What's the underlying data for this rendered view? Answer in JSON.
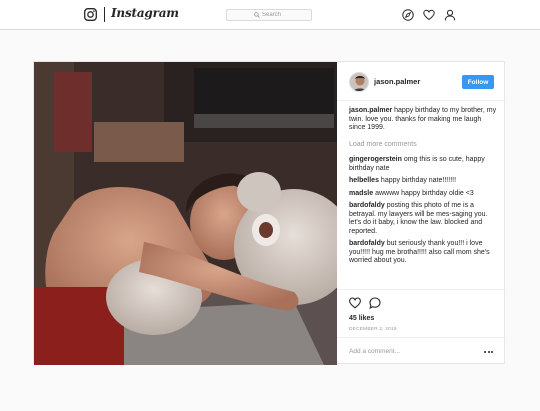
{
  "header": {
    "brand": "Instagram",
    "search_placeholder": "Search",
    "icons": [
      "instagram-glyph-icon",
      "compass-icon",
      "heart-icon",
      "profile-icon"
    ]
  },
  "post": {
    "username": "jason.palmer",
    "follow_label": "Follow",
    "photo_description_icon": "photo",
    "caption": {
      "user": "jason.palmer",
      "text": "happy birthday to my brother, my twin. love you. thanks for making me laugh since 1999."
    },
    "load_more": "Load more comments",
    "comments": [
      {
        "user": "gingerogerstein",
        "text": "omg this is so cute, happy birthday nate"
      },
      {
        "user": "helbelles",
        "text": "happy birthday nate!!!!!!!"
      },
      {
        "user": "madsle",
        "text": "awwww happy birthday oldie <3"
      },
      {
        "user": "bardofaldy",
        "text": "posting this photo of me is a betrayal. my lawyers will be mes-saging you. let's do it baby, i know the law. blocked and reported."
      },
      {
        "user": "bardofaldy",
        "text": "but seriously thank you!!! i love you!!!!! hug me brotha!!!!! also call mom she's worried about you."
      }
    ],
    "likes": "45 likes",
    "date": "DECEMBER 2, 2019",
    "add_comment_placeholder": "Add a comment..."
  },
  "colors": {
    "accent": "#3897f0",
    "page_bg": "#fafafa",
    "border": "#dbdbdb"
  }
}
